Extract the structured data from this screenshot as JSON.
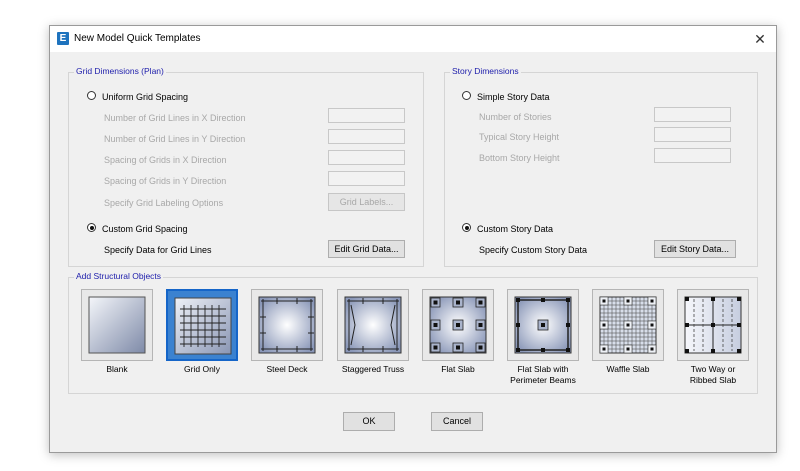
{
  "window": {
    "title": "New Model Quick Templates",
    "icon": "E",
    "close_glyph": "✕"
  },
  "grid": {
    "legend": "Grid Dimensions (Plan)",
    "uniform_label": "Uniform Grid Spacing",
    "fields": [
      "Number of Grid Lines in X Direction",
      "Number of Grid Lines in Y Direction",
      "Spacing of Grids in X Direction",
      "Spacing of Grids in Y Direction"
    ],
    "labeling_label": "Specify Grid Labeling Options",
    "grid_labels_button": "Grid Labels...",
    "custom_label": "Custom Grid Spacing",
    "custom_selected": true,
    "specify_label": "Specify Data for Grid Lines",
    "edit_button": "Edit Grid Data..."
  },
  "story": {
    "legend": "Story Dimensions",
    "simple_label": "Simple Story Data",
    "fields": [
      "Number of Stories",
      "Typical Story Height",
      "Bottom Story Height"
    ],
    "custom_label": "Custom Story Data",
    "custom_selected": true,
    "specify_label": "Specify Custom Story Data",
    "edit_button": "Edit Story Data..."
  },
  "objects": {
    "legend": "Add Structural Objects",
    "selected": "Grid Only",
    "items": [
      {
        "icon": "blank-template-icon",
        "line1": "Blank",
        "line2": ""
      },
      {
        "icon": "grid-only-template-icon",
        "line1": "Grid Only",
        "line2": ""
      },
      {
        "icon": "steel-deck-template-icon",
        "line1": "Steel Deck",
        "line2": ""
      },
      {
        "icon": "staggered-truss-template-icon",
        "line1": "Staggered Truss",
        "line2": ""
      },
      {
        "icon": "flat-slab-template-icon",
        "line1": "Flat Slab",
        "line2": ""
      },
      {
        "icon": "flat-slab-perimeter-beams-template-icon",
        "line1": "Flat Slab with",
        "line2": "Perimeter Beams"
      },
      {
        "icon": "waffle-slab-template-icon",
        "line1": "Waffle Slab",
        "line2": ""
      },
      {
        "icon": "two-way-ribbed-slab-template-icon",
        "line1": "Two Way or",
        "line2": "Ribbed Slab"
      }
    ]
  },
  "footer": {
    "ok": "OK",
    "cancel": "Cancel"
  },
  "colors": {
    "legend_text": "#1d1dab",
    "selection": "#1565c8",
    "disabled_text": "#a8a8a8"
  }
}
